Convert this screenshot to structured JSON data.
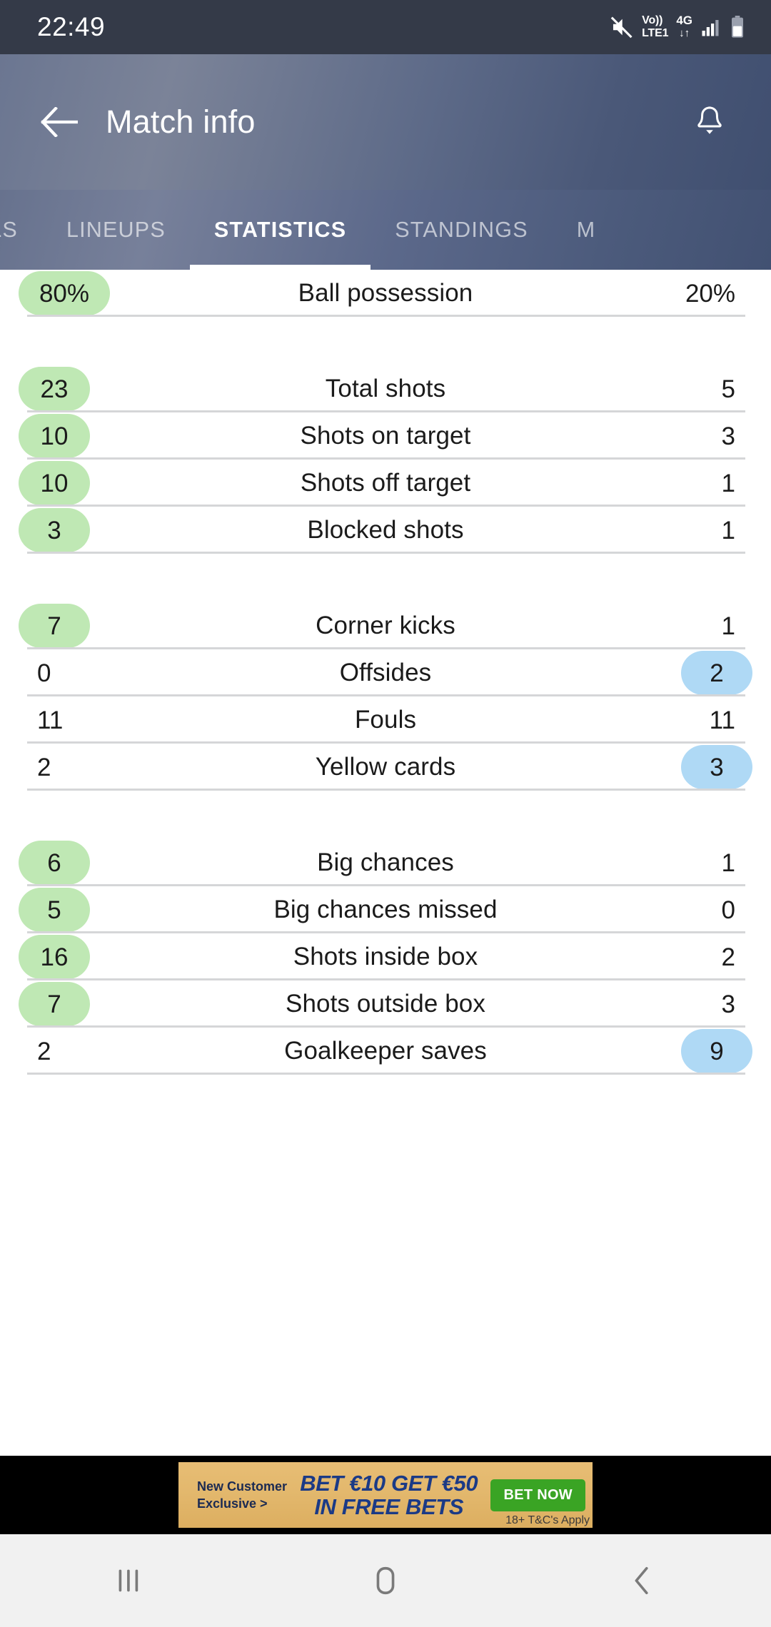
{
  "statusbar": {
    "time": "22:49",
    "icons": [
      "mute-icon",
      "volte-icon",
      "network-4g-icon",
      "signal-icon",
      "battery-icon"
    ],
    "volte_top": "Vo))",
    "volte_bottom": "LTE1",
    "network": "4G",
    "data_arrows": "↓↑"
  },
  "appbar": {
    "back_icon": "back-arrow-icon",
    "title": "Match info",
    "bell_icon": "notification-bell-icon"
  },
  "tabs": {
    "items": [
      {
        "label": "AILS",
        "active": false
      },
      {
        "label": "LINEUPS",
        "active": false
      },
      {
        "label": "STATISTICS",
        "active": true
      },
      {
        "label": "STANDINGS",
        "active": false
      },
      {
        "label": "M",
        "active": false
      }
    ],
    "active_index": 2
  },
  "stats": {
    "groups": [
      {
        "rows": [
          {
            "label": "Ball possession",
            "home": "80%",
            "away": "20%",
            "home_highlight": "green",
            "away_highlight": "none"
          }
        ]
      },
      {
        "rows": [
          {
            "label": "Total shots",
            "home": "23",
            "away": "5",
            "home_highlight": "green",
            "away_highlight": "none"
          },
          {
            "label": "Shots on target",
            "home": "10",
            "away": "3",
            "home_highlight": "green",
            "away_highlight": "none"
          },
          {
            "label": "Shots off target",
            "home": "10",
            "away": "1",
            "home_highlight": "green",
            "away_highlight": "none"
          },
          {
            "label": "Blocked shots",
            "home": "3",
            "away": "1",
            "home_highlight": "green",
            "away_highlight": "none"
          }
        ]
      },
      {
        "rows": [
          {
            "label": "Corner kicks",
            "home": "7",
            "away": "1",
            "home_highlight": "green",
            "away_highlight": "none"
          },
          {
            "label": "Offsides",
            "home": "0",
            "away": "2",
            "home_highlight": "none",
            "away_highlight": "blue"
          },
          {
            "label": "Fouls",
            "home": "11",
            "away": "11",
            "home_highlight": "none",
            "away_highlight": "none"
          },
          {
            "label": "Yellow cards",
            "home": "2",
            "away": "3",
            "home_highlight": "none",
            "away_highlight": "blue"
          }
        ]
      },
      {
        "rows": [
          {
            "label": "Big chances",
            "home": "6",
            "away": "1",
            "home_highlight": "green",
            "away_highlight": "none"
          },
          {
            "label": "Big chances missed",
            "home": "5",
            "away": "0",
            "home_highlight": "green",
            "away_highlight": "none"
          },
          {
            "label": "Shots inside box",
            "home": "16",
            "away": "2",
            "home_highlight": "green",
            "away_highlight": "none"
          },
          {
            "label": "Shots outside box",
            "home": "7",
            "away": "3",
            "home_highlight": "green",
            "away_highlight": "none"
          },
          {
            "label": "Goalkeeper saves",
            "home": "2",
            "away": "9",
            "home_highlight": "none",
            "away_highlight": "blue"
          }
        ]
      }
    ]
  },
  "ad": {
    "line1": "New Customer",
    "line2": "Exclusive >",
    "headline1": "BET €10 GET €50",
    "headline2": "IN FREE BETS",
    "cta": "BET NOW",
    "terms": "18+ T&C's Apply"
  },
  "navbar": {
    "recents_icon": "recents-icon",
    "home_icon": "home-icon",
    "back_icon": "nav-back-icon"
  },
  "colors": {
    "highlight_green": "#bfe8b4",
    "highlight_blue": "#afd9f5",
    "appbar_blue": "#5d6a88",
    "statusbar": "#343a48",
    "ad_gold": "#e3b86d",
    "ad_blue": "#1b3a86",
    "cta_green": "#3aa424"
  }
}
